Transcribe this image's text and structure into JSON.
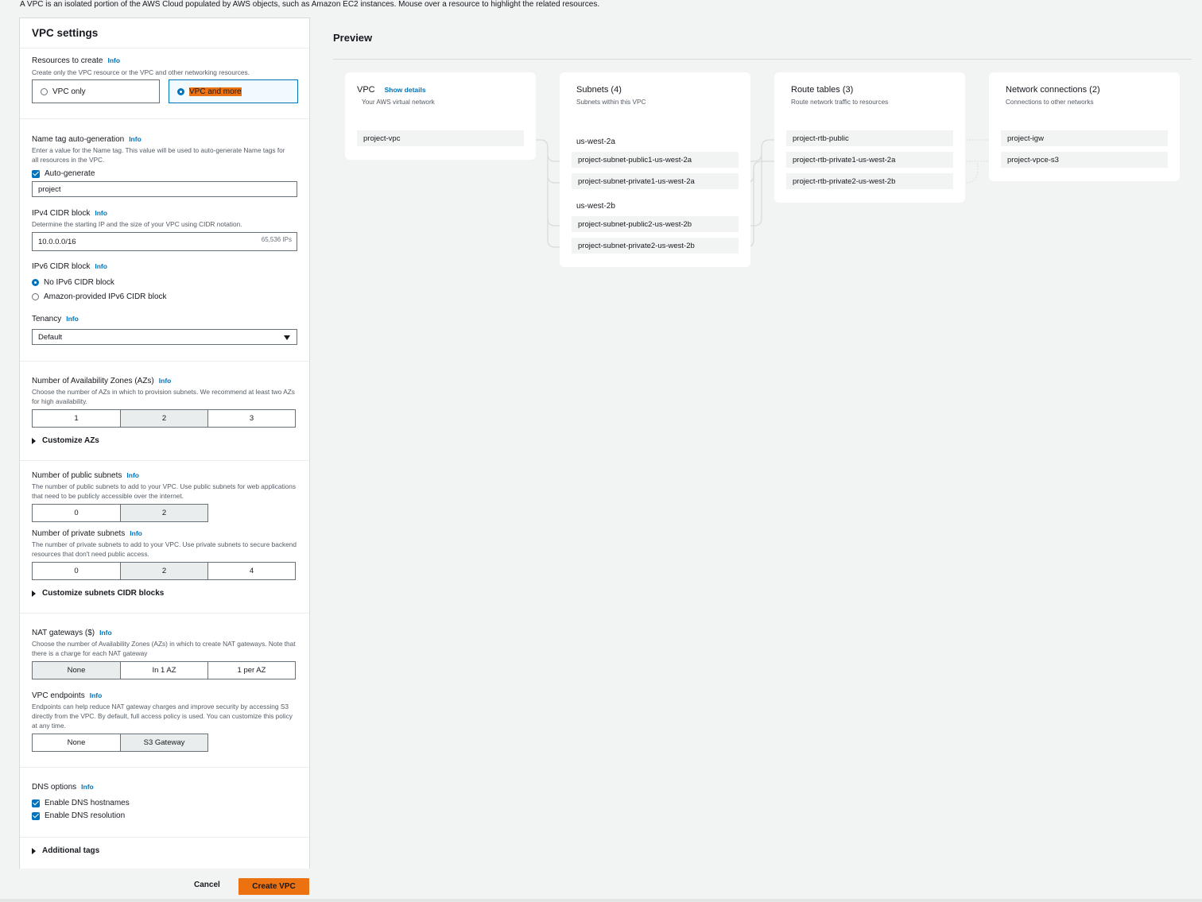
{
  "intro": "A VPC is an isolated portion of the AWS Cloud populated by AWS objects, such as Amazon EC2 instances. Mouse over a resource to highlight the related resources.",
  "settings": {
    "title": "VPC settings",
    "info": "Info",
    "resources": {
      "label": "Resources to create",
      "desc": "Create only the VPC resource or the VPC and other networking resources.",
      "opt_vpc_only": "VPC only",
      "opt_vpc_more": "VPC and more",
      "selected": "VPC and more"
    },
    "nametag": {
      "label": "Name tag auto-generation",
      "desc": "Enter a value for the Name tag. This value will be used to auto-generate Name tags for all resources in the VPC.",
      "auto_label": "Auto-generate",
      "auto_checked": true,
      "value": "project"
    },
    "ipv4": {
      "label": "IPv4 CIDR block",
      "desc": "Determine the starting IP and the size of your VPC using CIDR notation.",
      "value": "10.0.0.0/16",
      "ips": "65,536 IPs"
    },
    "ipv6": {
      "label": "IPv6 CIDR block",
      "opt_none": "No IPv6 CIDR block",
      "opt_amazon": "Amazon-provided IPv6 CIDR block",
      "selected": "No IPv6 CIDR block"
    },
    "tenancy": {
      "label": "Tenancy",
      "value": "Default"
    },
    "azs": {
      "label": "Number of Availability Zones (AZs)",
      "desc": "Choose the number of AZs in which to provision subnets. We recommend at least two AZs for high availability.",
      "options": [
        "1",
        "2",
        "3"
      ],
      "selected": "2",
      "customize": "Customize AZs"
    },
    "public_subnets": {
      "label": "Number of public subnets",
      "desc": "The number of public subnets to add to your VPC. Use public subnets for web applications that need to be publicly accessible over the internet.",
      "options": [
        "0",
        "2"
      ],
      "selected": "2"
    },
    "private_subnets": {
      "label": "Number of private subnets",
      "desc": "The number of private subnets to add to your VPC. Use private subnets to secure backend resources that don't need public access.",
      "options": [
        "0",
        "2",
        "4"
      ],
      "selected": "2",
      "customize": "Customize subnets CIDR blocks"
    },
    "nat": {
      "label": "NAT gateways ($)",
      "desc": "Choose the number of Availability Zones (AZs) in which to create NAT gateways. Note that there is a charge for each NAT gateway",
      "options": [
        "None",
        "In 1 AZ",
        "1 per AZ"
      ],
      "selected": "None"
    },
    "endpoints": {
      "label": "VPC endpoints",
      "desc": "Endpoints can help reduce NAT gateway charges and improve security by accessing S3 directly from the VPC. By default, full access policy is used. You can customize this policy at any time.",
      "options": [
        "None",
        "S3 Gateway"
      ],
      "selected": "S3 Gateway"
    },
    "dns": {
      "label": "DNS options",
      "hostnames": "Enable DNS hostnames",
      "hostnames_checked": true,
      "resolution": "Enable DNS resolution",
      "resolution_checked": true
    },
    "additional_tags": "Additional tags"
  },
  "actions": {
    "cancel": "Cancel",
    "create": "Create VPC"
  },
  "preview": {
    "title": "Preview",
    "vpc": {
      "title": "VPC",
      "show_details": "Show details",
      "sub": "Your AWS virtual network",
      "items": [
        "project-vpc"
      ]
    },
    "subnets": {
      "title": "Subnets (4)",
      "sub": "Subnets within this VPC",
      "az1": "us-west-2a",
      "az1_items": [
        "project-subnet-public1-us-west-2a",
        "project-subnet-private1-us-west-2a"
      ],
      "az2": "us-west-2b",
      "az2_items": [
        "project-subnet-public2-us-west-2b",
        "project-subnet-private2-us-west-2b"
      ]
    },
    "route_tables": {
      "title": "Route tables (3)",
      "sub": "Route network traffic to resources",
      "items": [
        "project-rtb-public",
        "project-rtb-private1-us-west-2a",
        "project-rtb-private2-us-west-2b"
      ]
    },
    "network": {
      "title": "Network connections (2)",
      "sub": "Connections to other networks",
      "items": [
        "project-igw",
        "project-vpce-s3"
      ]
    }
  },
  "colors": {
    "accent": "#0073bb",
    "primary_button": "#ec7211"
  }
}
